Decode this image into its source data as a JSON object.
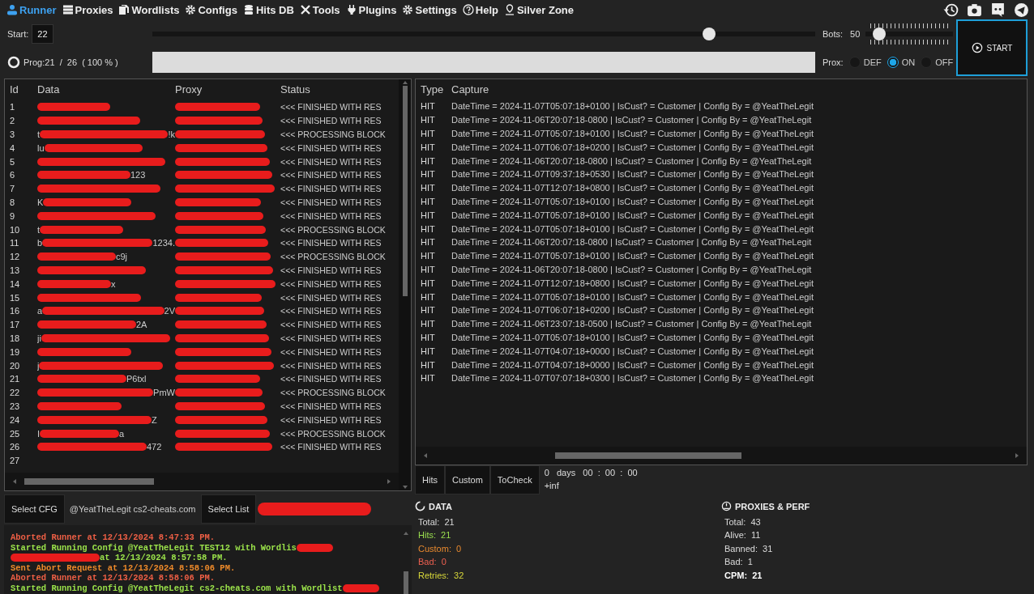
{
  "nav": [
    {
      "label": "Runner",
      "selected": true
    },
    {
      "label": "Proxies",
      "selected": false
    },
    {
      "label": "Wordlists",
      "selected": false
    },
    {
      "label": "Configs",
      "selected": false
    },
    {
      "label": "Hits DB",
      "selected": false
    },
    {
      "label": "Tools",
      "selected": false
    },
    {
      "label": "Plugins",
      "selected": false
    },
    {
      "label": "Settings",
      "selected": false
    },
    {
      "label": "Help",
      "selected": false
    },
    {
      "label": "Silver Zone",
      "selected": false
    }
  ],
  "start": {
    "label": "Start:",
    "value": "22",
    "level": 0.84
  },
  "bots": {
    "label": "Bots:",
    "value": "50",
    "level": 0.1
  },
  "start_button": "START",
  "progress": {
    "label": "Prog:",
    "text": "21  /  26  ( 100 % )",
    "level": 1
  },
  "proxy_mode": {
    "label": "Prox:",
    "options": [
      {
        "label": "DEF",
        "selected": false
      },
      {
        "label": "ON",
        "selected": true
      },
      {
        "label": "OFF",
        "selected": false
      }
    ]
  },
  "jobs_table": {
    "columns": [
      "Id",
      "Data",
      "Proxy",
      "Status"
    ],
    "rows": [
      {
        "id": "1",
        "status": "<<< FINISHED WITH RES"
      },
      {
        "id": "2",
        "status": "<<< FINISHED WITH RES"
      },
      {
        "id": "3",
        "data_prefix": "t",
        "data_suffix": "!k",
        "status": "<<< PROCESSING BLOCK"
      },
      {
        "id": "4",
        "data_prefix": "lu",
        "status": "<<< FINISHED WITH RES"
      },
      {
        "id": "5",
        "status": "<<< FINISHED WITH RES"
      },
      {
        "id": "6",
        "data_suffix": "123",
        "status": "<<< FINISHED WITH RES"
      },
      {
        "id": "7",
        "status": "<<< FINISHED WITH RES"
      },
      {
        "id": "8",
        "data_prefix": "K",
        "status": "<<< FINISHED WITH RES"
      },
      {
        "id": "9",
        "status": "<<< FINISHED WITH RES"
      },
      {
        "id": "10",
        "data_prefix": "t",
        "status": "<<< PROCESSING BLOCK"
      },
      {
        "id": "11",
        "data_prefix": "b",
        "data_suffix": "1234.",
        "status": "<<< FINISHED WITH RES"
      },
      {
        "id": "12",
        "data_suffix": "c9j",
        "status": "<<< PROCESSING BLOCK"
      },
      {
        "id": "13",
        "status": "<<< FINISHED WITH RES"
      },
      {
        "id": "14",
        "data_suffix": "x",
        "status": "<<< FINISHED WITH RES"
      },
      {
        "id": "15",
        "status": "<<< FINISHED WITH RES"
      },
      {
        "id": "16",
        "data_prefix": "a",
        "data_suffix": "2V",
        "status": "<<< FINISHED WITH RES"
      },
      {
        "id": "17",
        "data_suffix": "2A",
        "status": "<<< FINISHED WITH RES"
      },
      {
        "id": "18",
        "data_prefix": "ji",
        "status": "<<< FINISHED WITH RES"
      },
      {
        "id": "19",
        "status": "<<< FINISHED WITH RES"
      },
      {
        "id": "20",
        "data_prefix": "j",
        "status": "<<< FINISHED WITH RES"
      },
      {
        "id": "21",
        "data_suffix": "P6txl",
        "status": "<<< FINISHED WITH RES"
      },
      {
        "id": "22",
        "data_suffix": "PmW",
        "status": "<<< PROCESSING BLOCK"
      },
      {
        "id": "23",
        "status": "<<< FINISHED WITH RES"
      },
      {
        "id": "24",
        "data_suffix": "Z",
        "status": "<<< FINISHED WITH RES"
      },
      {
        "id": "25",
        "data_prefix": "I",
        "data_suffix": "a",
        "status": "<<< PROCESSING BLOCK"
      },
      {
        "id": "26",
        "data_suffix": "472",
        "status": "<<< FINISHED WITH RES"
      },
      {
        "id": "27"
      }
    ]
  },
  "hits_table": {
    "columns": [
      "Type",
      "Capture"
    ],
    "rows": [
      {
        "type": "HIT",
        "capture": "DateTime = 2024-11-07T05:07:18+0100 | IsCust? = Customer | Config By = @YeatTheLegit"
      },
      {
        "type": "HIT",
        "capture": "DateTime = 2024-11-06T20:07:18-0800 | IsCust? = Customer | Config By = @YeatTheLegit"
      },
      {
        "type": "HIT",
        "capture": "DateTime = 2024-11-07T05:07:18+0100 | IsCust? = Customer | Config By = @YeatTheLegit"
      },
      {
        "type": "HIT",
        "capture": "DateTime = 2024-11-07T06:07:18+0200 | IsCust? = Customer | Config By = @YeatTheLegit"
      },
      {
        "type": "HIT",
        "capture": "DateTime = 2024-11-06T20:07:18-0800 | IsCust? = Customer | Config By = @YeatTheLegit"
      },
      {
        "type": "HIT",
        "capture": "DateTime = 2024-11-07T09:37:18+0530 | IsCust? = Customer | Config By = @YeatTheLegit"
      },
      {
        "type": "HIT",
        "capture": "DateTime = 2024-11-07T12:07:18+0800 | IsCust? = Customer | Config By = @YeatTheLegit"
      },
      {
        "type": "HIT",
        "capture": "DateTime = 2024-11-07T05:07:18+0100 | IsCust? = Customer | Config By = @YeatTheLegit"
      },
      {
        "type": "HIT",
        "capture": "DateTime = 2024-11-07T05:07:18+0100 | IsCust? = Customer | Config By = @YeatTheLegit"
      },
      {
        "type": "HIT",
        "capture": "DateTime = 2024-11-07T05:07:18+0100 | IsCust? = Customer | Config By = @YeatTheLegit"
      },
      {
        "type": "HIT",
        "capture": "DateTime = 2024-11-06T20:07:18-0800 | IsCust? = Customer | Config By = @YeatTheLegit"
      },
      {
        "type": "HIT",
        "capture": "DateTime = 2024-11-07T05:07:18+0100 | IsCust? = Customer | Config By = @YeatTheLegit"
      },
      {
        "type": "HIT",
        "capture": "DateTime = 2024-11-06T20:07:18-0800 | IsCust? = Customer | Config By = @YeatTheLegit"
      },
      {
        "type": "HIT",
        "capture": "DateTime = 2024-11-07T12:07:18+0800 | IsCust? = Customer | Config By = @YeatTheLegit"
      },
      {
        "type": "HIT",
        "capture": "DateTime = 2024-11-07T05:07:18+0100 | IsCust? = Customer | Config By = @YeatTheLegit"
      },
      {
        "type": "HIT",
        "capture": "DateTime = 2024-11-07T06:07:18+0200 | IsCust? = Customer | Config By = @YeatTheLegit"
      },
      {
        "type": "HIT",
        "capture": "DateTime = 2024-11-06T23:07:18-0500 | IsCust? = Customer | Config By = @YeatTheLegit"
      },
      {
        "type": "HIT",
        "capture": "DateTime = 2024-11-07T05:07:18+0100 | IsCust? = Customer | Config By = @YeatTheLegit"
      },
      {
        "type": "HIT",
        "capture": "DateTime = 2024-11-07T04:07:18+0000 | IsCust? = Customer | Config By = @YeatTheLegit"
      },
      {
        "type": "HIT",
        "capture": "DateTime = 2024-11-07T04:07:18+0000 | IsCust? = Customer | Config By = @YeatTheLegit"
      },
      {
        "type": "HIT",
        "capture": "DateTime = 2024-11-07T07:07:18+0300 | IsCust? = Customer | Config By = @YeatTheLegit"
      }
    ]
  },
  "result_tabs": [
    "Hits",
    "Custom",
    "ToCheck"
  ],
  "timer": {
    "elapsed": "0   days   00  :  00  :  00",
    "remaining": "+inf"
  },
  "config_bar": {
    "config_button": "Select CFG",
    "config_name": "@YeatTheLegit cs2-cheats.com",
    "list_button": "Select List",
    "list_redacted": true
  },
  "log": [
    {
      "kind": "aborted",
      "text": "Aborted Runner at 12/13/2024 8:47:33 PM."
    },
    {
      "kind": "started",
      "text": "Started Running Config @YeatTheLegit TEST12 with Wordlis",
      "redacted_after": true
    },
    {
      "kind": "started",
      "text": "at 12/13/2024 8:57:58 PM.",
      "redacted_before": true
    },
    {
      "kind": "abort_request",
      "text": "Sent Abort Request at 12/13/2024 8:58:06 PM."
    },
    {
      "kind": "aborted",
      "text": "Aborted Runner at 12/13/2024 8:58:06 PM."
    },
    {
      "kind": "started",
      "text": "Started Running Config @YeatTheLegit cs2-cheats.com with Wordlist",
      "redacted_after": true
    }
  ],
  "data_stats": {
    "title": "DATA",
    "items": [
      {
        "kind": "total",
        "label": "Total:",
        "value": "21"
      },
      {
        "kind": "hits",
        "label": "Hits:",
        "value": "21"
      },
      {
        "kind": "custom",
        "label": "Custom:",
        "value": "0"
      },
      {
        "kind": "bad",
        "label": "Bad:",
        "value": "0"
      },
      {
        "kind": "retries",
        "label": "Retries:",
        "value": "32"
      }
    ]
  },
  "proxy_stats": {
    "title": "PROXIES & PERF",
    "items": [
      {
        "kind": "total",
        "label": "Total:",
        "value": "43"
      },
      {
        "kind": "total",
        "label": "Alive:",
        "value": "11"
      },
      {
        "kind": "total",
        "label": "Banned:",
        "value": "31"
      },
      {
        "kind": "total",
        "label": "Bad:",
        "value": "1"
      },
      {
        "kind": "cpm",
        "label": "CPM:",
        "value": "21"
      }
    ]
  }
}
